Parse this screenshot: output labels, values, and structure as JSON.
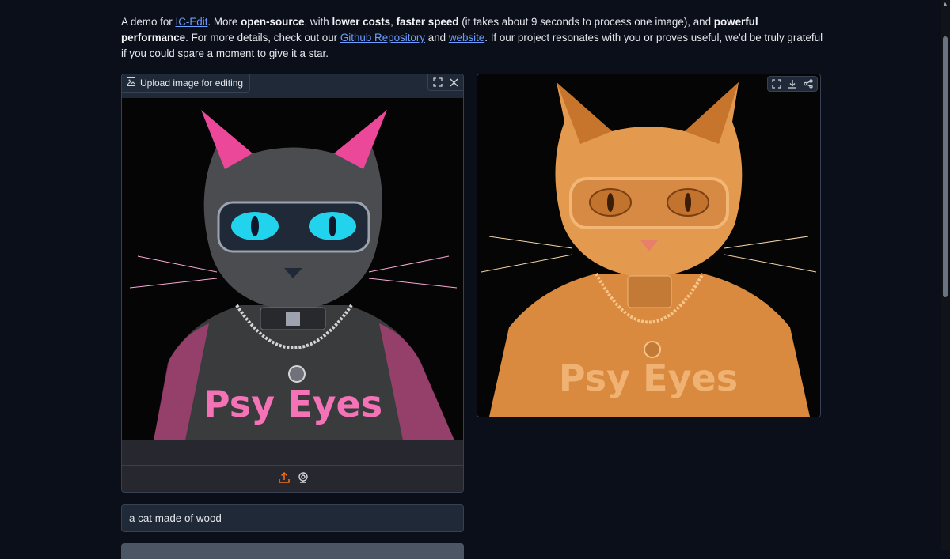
{
  "intro": {
    "t1": "A demo for ",
    "link_icedit": "IC-Edit",
    "t2": ". More ",
    "b1": "open-source",
    "t3": ", with ",
    "b2": "lower costs",
    "t4": ", ",
    "b3": "faster speed",
    "t5": " (it takes about 9 seconds to process one image), and ",
    "b4": "powerful performance",
    "t6": ". For more details, check out our ",
    "link_github": "Github Repository",
    "t7": " and ",
    "link_website": "website",
    "t8": ". If our project resonates with you or proves useful, we'd be truly grateful if you could spare a moment to give it a star."
  },
  "input_panel": {
    "label": "Upload image for editing",
    "label_icon": "image-icon",
    "tools": [
      "fullscreen-icon",
      "close-icon"
    ],
    "footer_icons": [
      "upload-icon",
      "webcam-icon"
    ],
    "image_text": "Psy Eyes"
  },
  "output_panel": {
    "tools": [
      "fullscreen-icon",
      "download-icon",
      "share-icon"
    ],
    "image_text": "Psy Eyes"
  },
  "prompt": {
    "value": "a cat made of wood"
  },
  "colors": {
    "background": "#0b0f19",
    "link": "#6d9dfd",
    "upload_accent": "#f97316"
  }
}
